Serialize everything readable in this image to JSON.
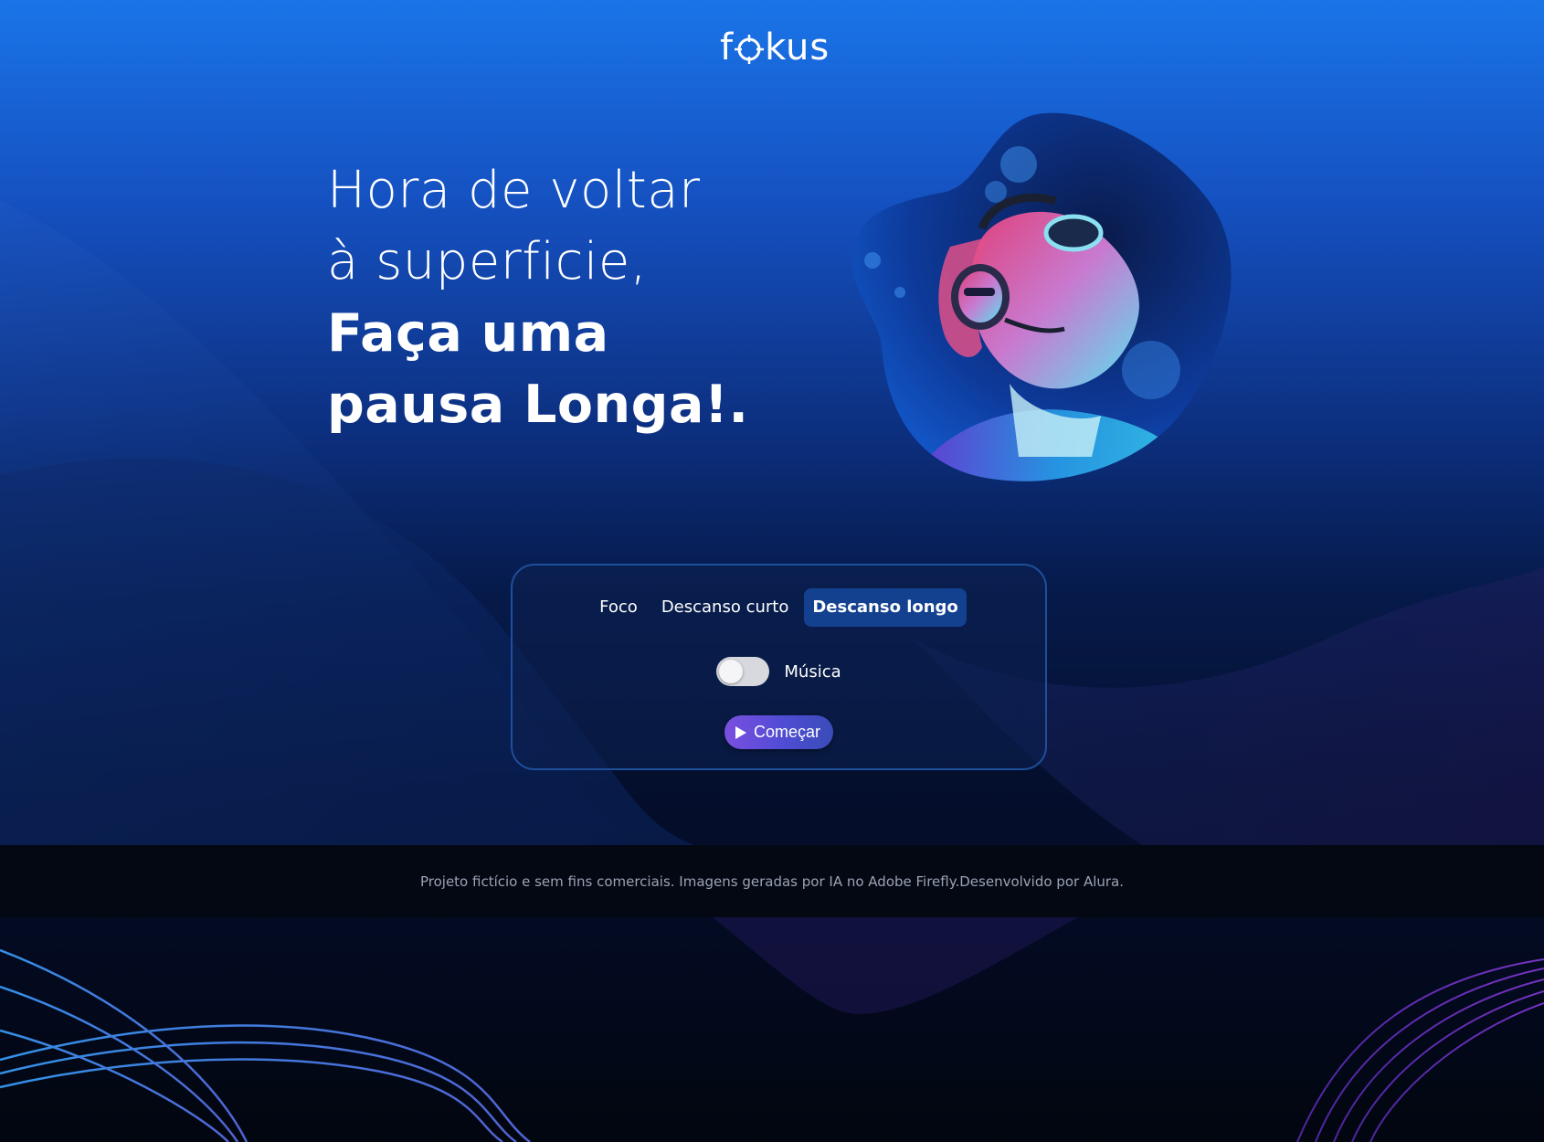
{
  "app": {
    "logo_text_left": "f",
    "logo_text_right": "kus"
  },
  "hero": {
    "line1": "Hora de voltar",
    "line2": "à superficie,",
    "line3": "Faça uma",
    "line4": "pausa Longa!."
  },
  "timer_card": {
    "tabs": [
      {
        "label": "Foco",
        "active": false
      },
      {
        "label": "Descanso curto",
        "active": false
      },
      {
        "label": "Descanso longo",
        "active": true
      }
    ],
    "music_toggle": {
      "label": "Música",
      "on": false
    },
    "start_button": {
      "label": "Começar",
      "icon": "play-icon"
    }
  },
  "footer": {
    "text": "Projeto fictício e sem fins comerciais. Imagens geradas por IA no Adobe Firefly.Desenvolvido por Alura."
  },
  "colors": {
    "accent_purple": "#7b4fe0",
    "active_tab": "#14418f",
    "card_border": "#1d4f9a"
  }
}
